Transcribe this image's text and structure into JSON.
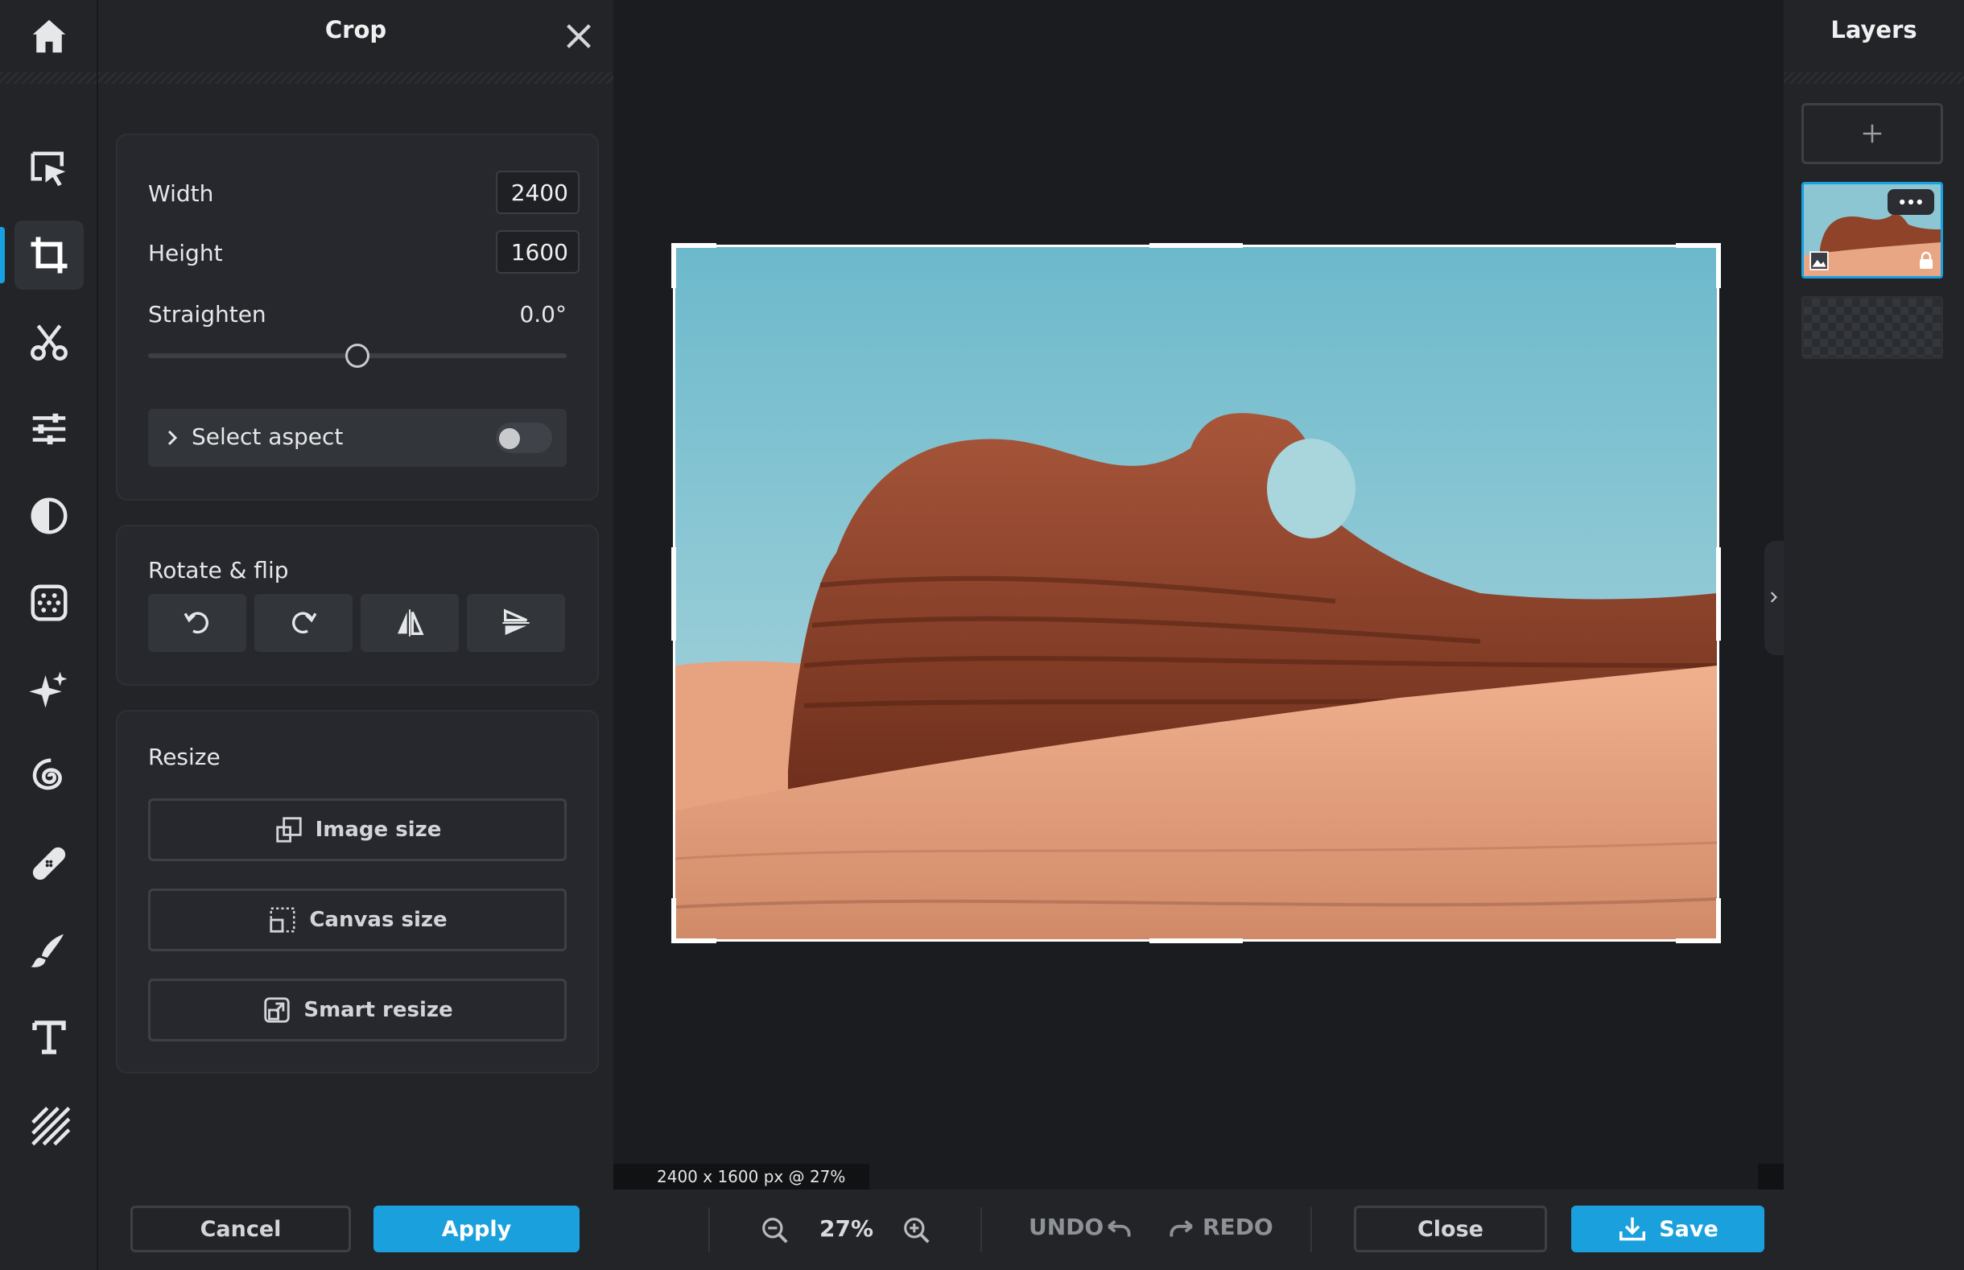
{
  "crop_panel": {
    "title": "Crop",
    "width_label": "Width",
    "width_value": "2400",
    "height_label": "Height",
    "height_value": "1600",
    "straighten_label": "Straighten",
    "straighten_value": "0.0°",
    "straighten_level": 0.5,
    "select_aspect_label": "Select aspect",
    "select_aspect_enabled": false,
    "rotate_flip_label": "Rotate & flip",
    "resize_label": "Resize",
    "image_size_label": "Image size",
    "canvas_size_label": "Canvas size",
    "smart_resize_label": "Smart resize"
  },
  "canvas": {
    "status_text": "2400 x 1600 px @ 27%"
  },
  "layers": {
    "title": "Layers"
  },
  "bottom_bar": {
    "cancel_label": "Cancel",
    "apply_label": "Apply",
    "zoom_value": "27%",
    "undo_label": "UNDO",
    "redo_label": "REDO",
    "close_label": "Close",
    "save_label": "Save"
  },
  "colors": {
    "accent": "#1aa0dc",
    "background": "#1b1c1f",
    "panel": "#222428"
  },
  "icons": [
    "home-icon",
    "select-icon",
    "crop-icon",
    "cut-icon",
    "adjust-icon",
    "filter-icon",
    "effects-icon",
    "magic-icon",
    "liquify-icon",
    "retouch-icon",
    "draw-icon",
    "text-icon",
    "texture-icon"
  ]
}
